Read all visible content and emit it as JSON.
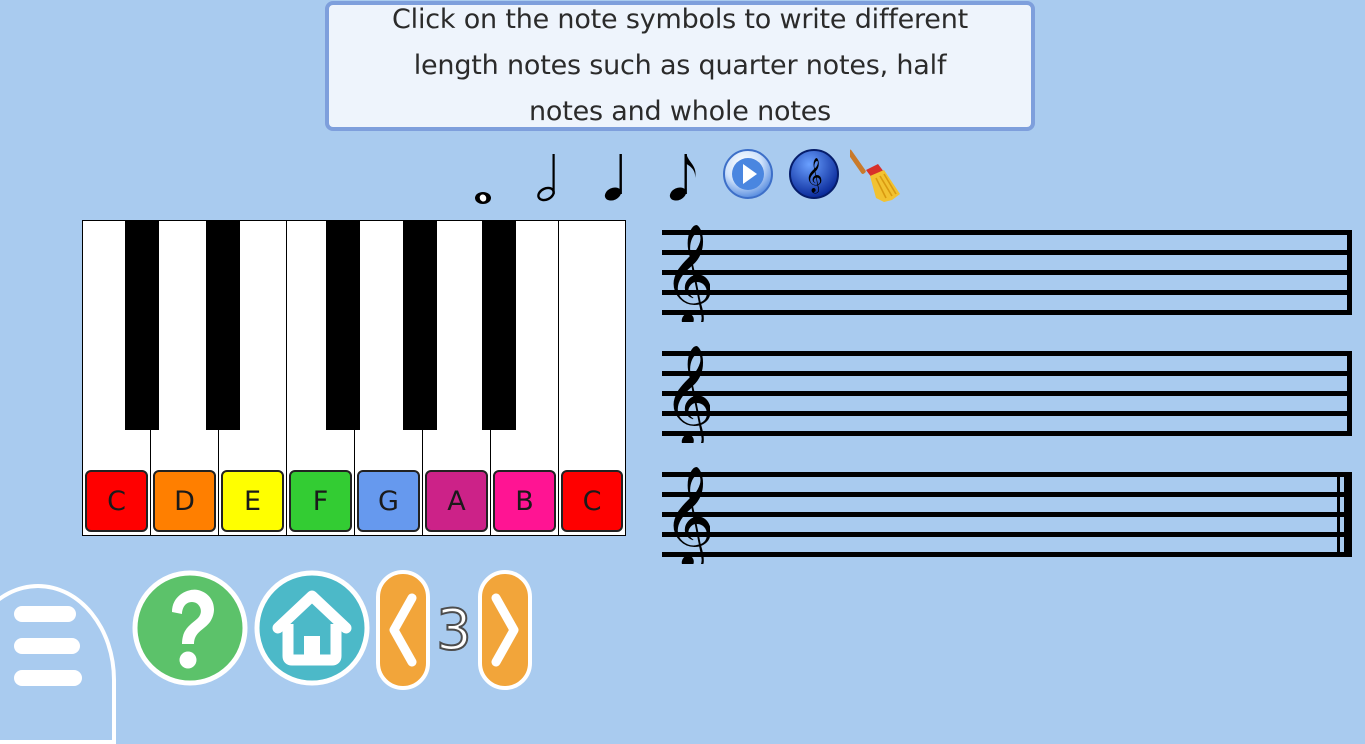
{
  "instructions": {
    "line1": "Click on the note symbols to write different",
    "line2": "length notes such as quarter notes, half",
    "line3": "notes and whole notes"
  },
  "toolbar": {
    "tools": [
      {
        "icon": "whole-note-icon"
      },
      {
        "icon": "half-note-icon"
      },
      {
        "icon": "quarter-note-icon"
      },
      {
        "icon": "eighth-note-icon"
      },
      {
        "icon": "play-icon"
      },
      {
        "icon": "treble-clef-icon"
      },
      {
        "icon": "broom-icon"
      }
    ]
  },
  "piano": {
    "white_keys": [
      {
        "label": "C",
        "color": "#ff0000"
      },
      {
        "label": "D",
        "color": "#ff7f00"
      },
      {
        "label": "E",
        "color": "#ffff00"
      },
      {
        "label": "F",
        "color": "#33cc33"
      },
      {
        "label": "G",
        "color": "#6699ee"
      },
      {
        "label": "A",
        "color": "#cc2288"
      },
      {
        "label": "B",
        "color": "#ff1493"
      },
      {
        "label": "C",
        "color": "#ff0000"
      }
    ]
  },
  "staves": [
    {
      "clef": "treble-clef-icon",
      "end": "single-barline"
    },
    {
      "clef": "treble-clef-icon",
      "end": "single-barline"
    },
    {
      "clef": "treble-clef-icon",
      "end": "final-double-barline"
    }
  ],
  "navigation": {
    "menu_icon": "hamburger-icon",
    "help_icon": "question-mark-icon",
    "home_icon": "home-icon",
    "prev_icon": "chevron-left-icon",
    "next_icon": "chevron-right-icon",
    "page_number": "3"
  },
  "colors": {
    "background": "#a9cbef",
    "help_button": "#5cc26a",
    "home_button": "#4cb9c8",
    "arrow_button": "#f2a53a"
  }
}
